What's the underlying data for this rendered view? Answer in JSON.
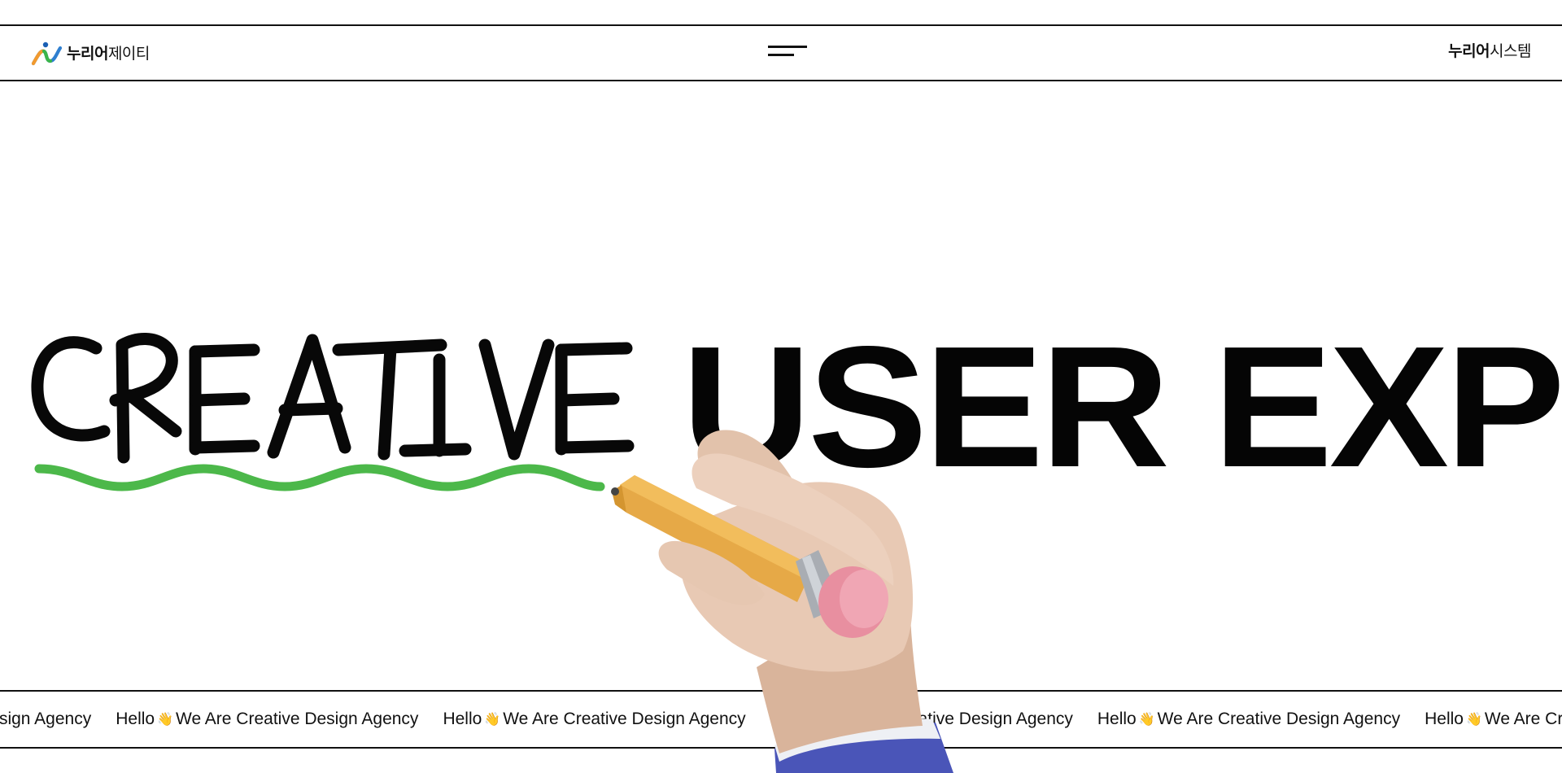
{
  "header": {
    "logo_strong": "누리어",
    "logo_light": "제이티",
    "menu_icon": "hamburger-menu-icon",
    "right_strong": "누리어",
    "right_light": "시스템"
  },
  "hero": {
    "script_word": "CREATIVE",
    "headline": "USER EXPER",
    "underline_color": "#4cb84a",
    "illustration": "hand-holding-pencil"
  },
  "marquee": {
    "hello": "Hello",
    "wave_icon": "👋",
    "tagline": "We Are Creative Design Agency",
    "leading_fragment": "re Creative Design Agency",
    "trailing_fragment": "Hello"
  },
  "colors": {
    "accent_green": "#4cb84a",
    "pencil": "#e6a947",
    "eraser": "#e88fa0",
    "text": "#111111"
  }
}
